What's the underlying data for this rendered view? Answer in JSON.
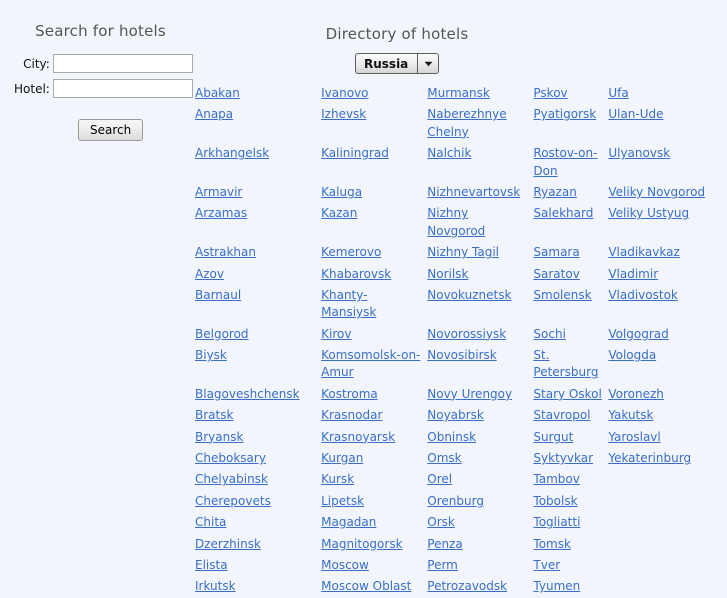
{
  "search": {
    "heading": "Search for hotels",
    "city_label": "City:",
    "city_value": "",
    "city_placeholder": "",
    "hotel_label": "Hotel:",
    "hotel_value": "",
    "hotel_placeholder": "",
    "button_label": "Search"
  },
  "directory": {
    "heading": "Directory of hotels",
    "country_selected": "Russia",
    "country_options": [
      "Russia"
    ],
    "dropdown_icon": "chevron-down-icon",
    "columns": [
      [
        "Abakan",
        "Anapa",
        "Arkhangelsk",
        "Armavir",
        "Arzamas",
        "Astrakhan",
        "Azov",
        "Barnaul",
        "Belgorod",
        "Biysk",
        "Blagoveshchensk",
        "Bratsk",
        "Bryansk",
        "Cheboksary",
        "Chelyabinsk",
        "Cherepovets",
        "Chita",
        "Dzerzhinsk",
        "Elista",
        "Irkutsk"
      ],
      [
        "Ivanovo",
        "Izhevsk",
        "Kaliningrad",
        "Kaluga",
        "Kazan",
        "Kemerovo",
        "Khabarovsk",
        "Khanty-Mansiysk",
        "Kirov",
        "Komsomolsk-on-Amur",
        "Kostroma",
        "Krasnodar",
        "Krasnoyarsk",
        "Kurgan",
        "Kursk",
        "Lipetsk",
        "Magadan",
        "Magnitogorsk",
        "Moscow",
        "Moscow Oblast"
      ],
      [
        "Murmansk",
        "Naberezhnye Chelny",
        "Nalchik",
        "Nizhnevartovsk",
        "Nizhny Novgorod",
        "Nizhny Tagil",
        "Norilsk",
        "Novokuznetsk",
        "Novorossiysk",
        "Novosibirsk",
        "Novy Urengoy",
        "Noyabrsk",
        "Obninsk",
        "Omsk",
        "Orel",
        "Orenburg",
        "Orsk",
        "Penza",
        "Perm",
        "Petrozavodsk"
      ],
      [
        "Pskov",
        "Pyatigorsk",
        "Rostov-on-Don",
        "Ryazan",
        "Salekhard",
        "Samara",
        "Saratov",
        "Smolensk",
        "Sochi",
        "St. Petersburg",
        "Stary Oskol",
        "Stavropol",
        "Surgut",
        "Syktyvkar",
        "Tambov",
        "Tobolsk",
        "Togliatti",
        "Tomsk",
        "Tver",
        "Tyumen"
      ],
      [
        "Ufa",
        "Ulan-Ude",
        "Ulyanovsk",
        "Veliky Novgorod",
        "Veliky Ustyug",
        "Vladikavkaz",
        "Vladimir",
        "Vladivostok",
        "Volgograd",
        "Vologda",
        "Voronezh",
        "Yakutsk",
        "Yaroslavl",
        "Yekaterinburg",
        "",
        "",
        "",
        "",
        "",
        ""
      ]
    ]
  },
  "colors": {
    "background": "#f2f6fc",
    "link": "#3b6fc4",
    "heading": "#555555"
  }
}
